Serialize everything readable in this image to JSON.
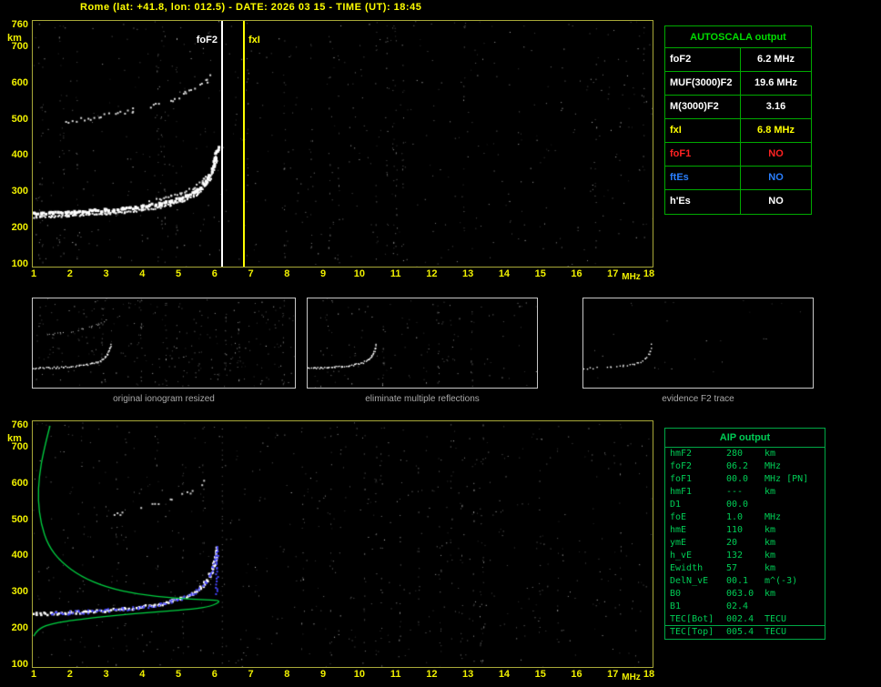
{
  "title": "Rome (lat: +41.8, lon: 012.5) - DATE: 2026 03 15 - TIME (UT): 18:45",
  "colors": {
    "background": "#000000",
    "title_text": "#ffff00",
    "axis_text": "#f0f000",
    "plot_border": "#a8a838",
    "thumb_border": "#c8c8c8",
    "caption_text": "#a8a8a8",
    "autoscala_border": "#00aa00",
    "autoscala_title": "#00dd00",
    "aip_border": "#00a846",
    "aip_text": "#00cc55",
    "white": "#ffffff",
    "yellow": "#ffff00",
    "red": "#ff2222",
    "blue": "#2a7fff",
    "trace_blue": "#4646ff",
    "profile_green": "#00d040"
  },
  "axes": {
    "x_unit": "MHz",
    "y_unit": "km",
    "x_ticks": [
      1,
      2,
      3,
      4,
      5,
      6,
      7,
      8,
      9,
      10,
      11,
      12,
      13,
      14,
      15,
      16,
      17,
      18
    ],
    "y_ticks": [
      760,
      700,
      600,
      500,
      400,
      300,
      200,
      100
    ],
    "x_range": [
      1,
      18
    ],
    "y_range": [
      100,
      760
    ]
  },
  "top_plot": {
    "markers": [
      {
        "label": "foF2",
        "freq_mhz": 6.2,
        "color": "#ffffff",
        "label_side": "left"
      },
      {
        "label": "fxI",
        "freq_mhz": 6.8,
        "color": "#ffff00",
        "label_side": "right"
      }
    ]
  },
  "autoscala": {
    "title": "AUTOSCALA output",
    "rows": [
      {
        "label": "foF2",
        "value": "6.2 MHz",
        "color": "#ffffff"
      },
      {
        "label": "MUF(3000)F2",
        "value": "19.6 MHz",
        "color": "#ffffff"
      },
      {
        "label": "M(3000)F2",
        "value": "3.16",
        "color": "#ffffff"
      },
      {
        "label": "fxI",
        "value": "6.8 MHz",
        "color": "#ffff00"
      },
      {
        "label": "foF1",
        "value": "NO",
        "color": "#ff2222"
      },
      {
        "label": "ftEs",
        "value": "NO",
        "color": "#2a7fff"
      },
      {
        "label": "h'Es",
        "value": "NO",
        "color": "#ffffff"
      }
    ]
  },
  "thumbnails": [
    {
      "caption": "original ionogram resized"
    },
    {
      "caption": "eliminate multiple reflections"
    },
    {
      "caption": "evidence F2 trace"
    }
  ],
  "aip": {
    "title": "AIP output",
    "rows": [
      {
        "name": "hmF2",
        "value": "280",
        "unit": "km"
      },
      {
        "name": "foF2",
        "value": "06.2",
        "unit": "MHz"
      },
      {
        "name": "foF1",
        "value": "00.0",
        "unit": "MHz  [PN]"
      },
      {
        "name": "hmF1",
        "value": "---",
        "unit": "km"
      },
      {
        "name": "D1",
        "value": "00.0",
        "unit": ""
      },
      {
        "name": "foE",
        "value": "1.0",
        "unit": "MHz"
      },
      {
        "name": "hmE",
        "value": "110",
        "unit": "km"
      },
      {
        "name": "ymE",
        "value": "20",
        "unit": "km"
      },
      {
        "name": "h_vE",
        "value": "132",
        "unit": "km"
      },
      {
        "name": "Ewidth",
        "value": "57",
        "unit": "km"
      },
      {
        "name": "DelN_vE",
        "value": "00.1",
        "unit": "m^(-3)"
      },
      {
        "name": "B0",
        "value": "063.0",
        "unit": "km"
      },
      {
        "name": "B1",
        "value": "02.4",
        "unit": ""
      },
      {
        "name": "TEC[Bot]",
        "value": "002.4",
        "unit": "TECU",
        "underline": true
      },
      {
        "name": "TEC[Top]",
        "value": "005.4",
        "unit": "TECU"
      }
    ]
  },
  "chart_data": {
    "type": "scatter",
    "title": "Ionogram traces with autoscaled parameters (top) and AIP inversion profile (bottom)",
    "xlabel": "MHz",
    "ylabel": "km",
    "xlim": [
      1,
      18
    ],
    "ylim": [
      100,
      760
    ],
    "foF2_mhz": 6.2,
    "fxI_mhz": 6.8,
    "f2_trace": [
      [
        1.0,
        240
      ],
      [
        1.5,
        242
      ],
      [
        2.0,
        244
      ],
      [
        2.5,
        247
      ],
      [
        3.0,
        250
      ],
      [
        3.5,
        254
      ],
      [
        4.0,
        260
      ],
      [
        4.5,
        268
      ],
      [
        4.8,
        275
      ],
      [
        5.1,
        284
      ],
      [
        5.4,
        297
      ],
      [
        5.6,
        311
      ],
      [
        5.75,
        327
      ],
      [
        5.88,
        348
      ],
      [
        5.97,
        372
      ],
      [
        6.04,
        398
      ],
      [
        6.09,
        425
      ]
    ],
    "second_hop_trace": [
      [
        1.9,
        495
      ],
      [
        2.3,
        500
      ],
      [
        2.8,
        507
      ],
      [
        3.3,
        516
      ],
      [
        3.8,
        527
      ],
      [
        4.3,
        540
      ],
      [
        4.8,
        556
      ],
      [
        5.2,
        572
      ],
      [
        5.5,
        588
      ],
      [
        5.75,
        604
      ],
      [
        5.9,
        618
      ]
    ],
    "profile_topside": [
      [
        1.45,
        760
      ],
      [
        1.27,
        690
      ],
      [
        1.15,
        620
      ],
      [
        1.12,
        555
      ],
      [
        1.2,
        490
      ],
      [
        1.4,
        430
      ],
      [
        1.75,
        385
      ],
      [
        2.3,
        345
      ],
      [
        3.0,
        315
      ],
      [
        3.9,
        295
      ],
      [
        4.9,
        285
      ],
      [
        5.8,
        280
      ],
      [
        6.2,
        278
      ]
    ],
    "profile_bottomside": [
      [
        6.2,
        278
      ],
      [
        5.9,
        262
      ],
      [
        5.4,
        255
      ],
      [
        4.6,
        248
      ],
      [
        3.8,
        242
      ],
      [
        3.0,
        235
      ],
      [
        2.3,
        227
      ],
      [
        1.7,
        218
      ],
      [
        1.3,
        208
      ],
      [
        1.1,
        196
      ],
      [
        1.0,
        180
      ]
    ],
    "blue_trace_frange": [
      1.5,
      6.05
    ],
    "ox_strand_frange": [
      4.2,
      5.8
    ],
    "ox_strand_offset_km": 13
  }
}
